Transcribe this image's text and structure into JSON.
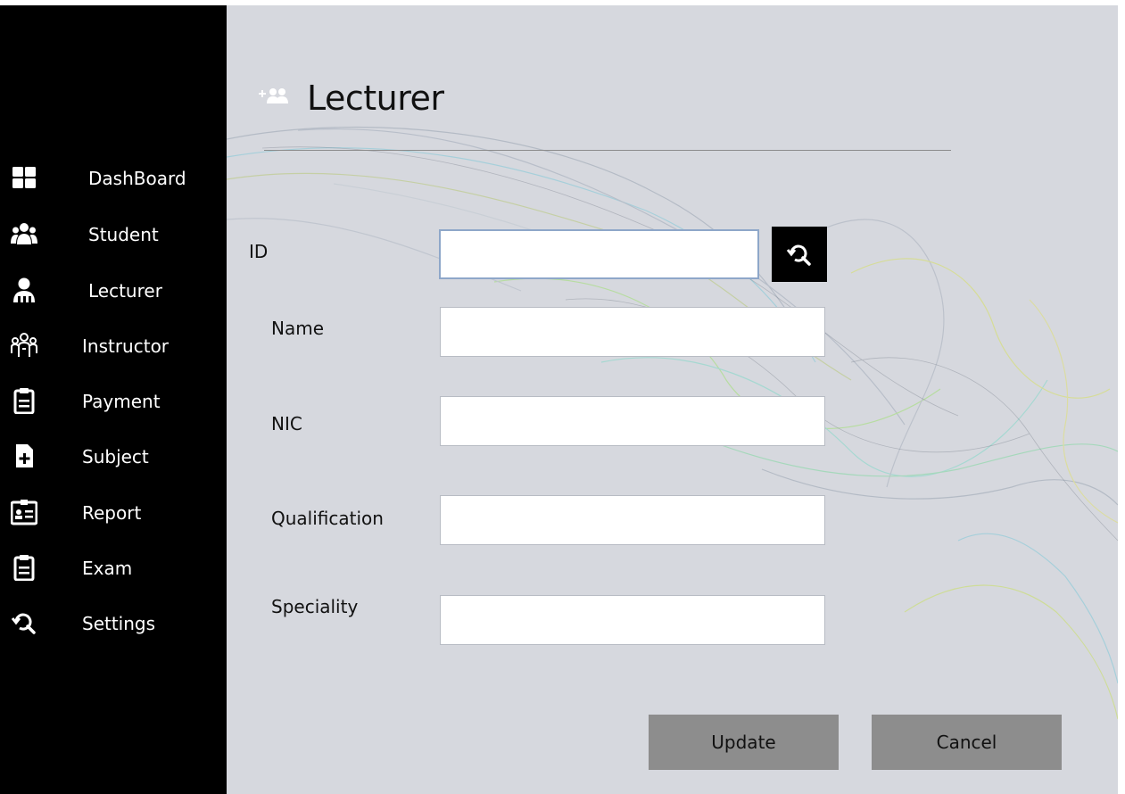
{
  "sidebar": {
    "items": [
      {
        "label": "DashBoard",
        "icon": "dashboard-icon"
      },
      {
        "label": "Student",
        "icon": "users-group-icon"
      },
      {
        "label": "Lecturer",
        "icon": "lecturer-icon"
      },
      {
        "label": "Instructor",
        "icon": "instructor-icon"
      },
      {
        "label": "Payment",
        "icon": "clipboard-icon"
      },
      {
        "label": "Subject",
        "icon": "file-add-icon"
      },
      {
        "label": "Report",
        "icon": "id-card-icon"
      },
      {
        "label": "Exam",
        "icon": "clipboard-icon"
      },
      {
        "label": "Settings",
        "icon": "search-refresh-icon"
      }
    ]
  },
  "header": {
    "title": "Lecturer",
    "icon": "add-user-icon"
  },
  "form": {
    "id_label": "ID",
    "id_value": "",
    "name_label": "Name",
    "name_value": "",
    "nic_label": "NIC",
    "nic_value": "",
    "qualification_label": "Qualification",
    "qualification_value": "",
    "speciality_label": "Speciality",
    "speciality_value": "",
    "search_icon": "search-refresh-icon"
  },
  "actions": {
    "update_label": "Update",
    "cancel_label": "Cancel"
  },
  "colors": {
    "sidebar_bg": "#000000",
    "main_bg": "#d6d8de",
    "button_bg": "#8d8d8d",
    "focus_border": "#8ea7c9"
  }
}
